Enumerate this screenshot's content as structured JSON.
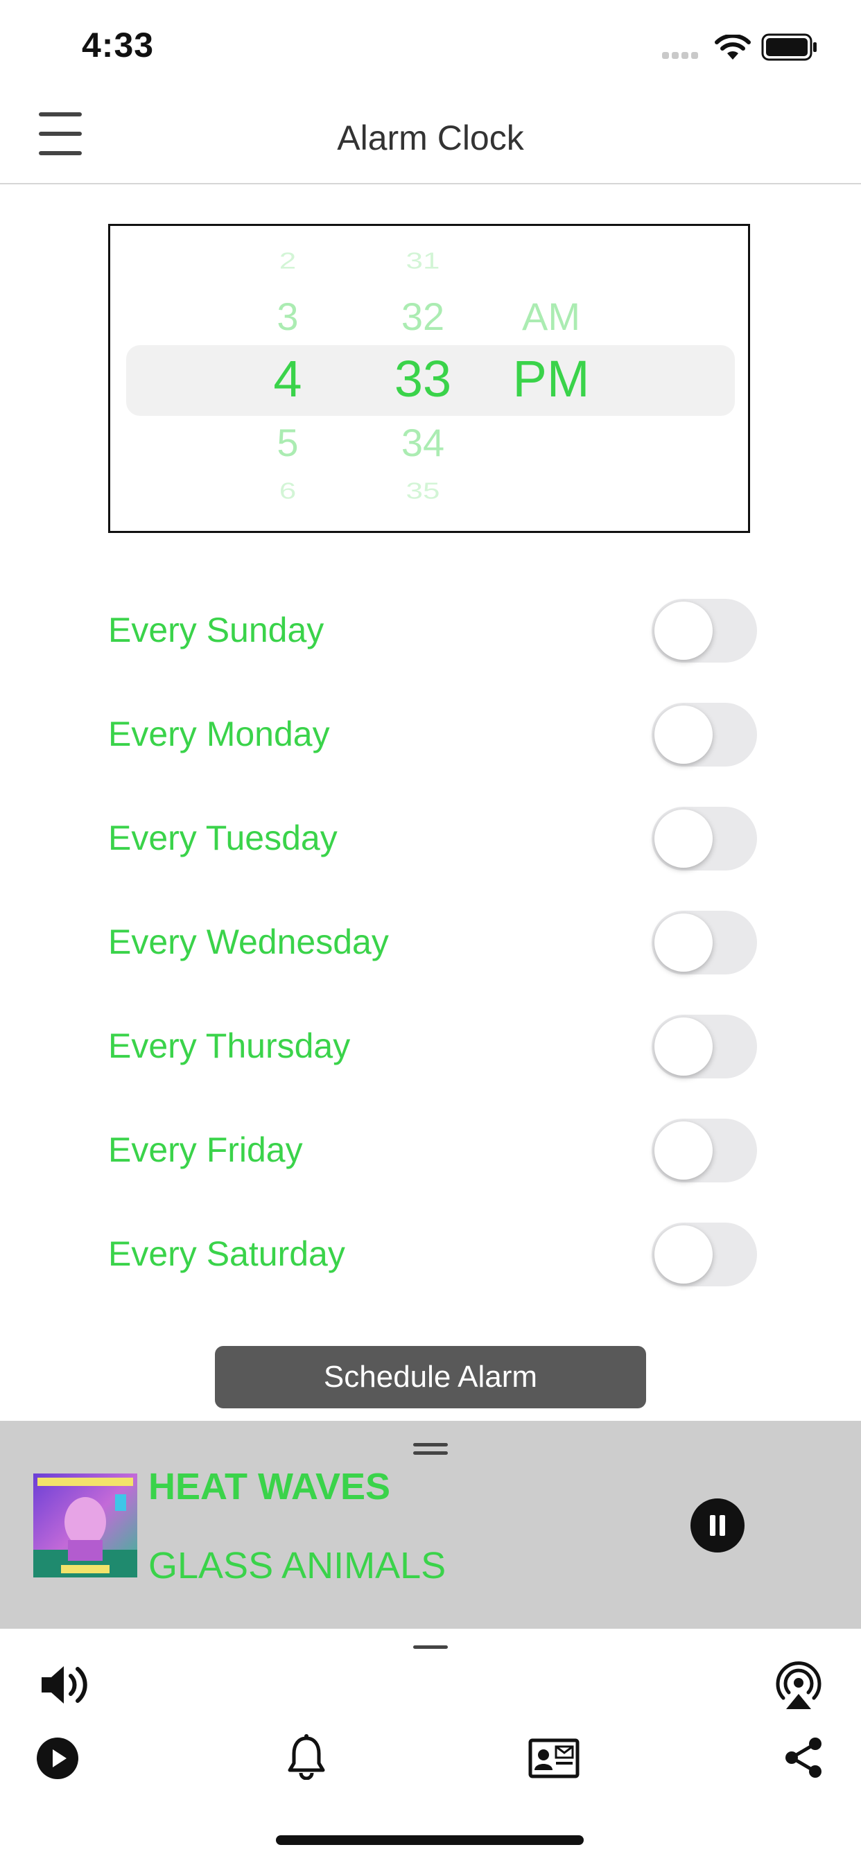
{
  "status_bar": {
    "time": "4:33"
  },
  "nav": {
    "title": "Alarm Clock"
  },
  "picker": {
    "hours": [
      "2",
      "3",
      "4",
      "5",
      "6"
    ],
    "minutes": [
      "31",
      "32",
      "33",
      "34",
      "35"
    ],
    "ampm": [
      "AM",
      "PM"
    ],
    "selected": {
      "hour": "4",
      "minute": "33",
      "ampm": "PM"
    }
  },
  "days": [
    {
      "label": "Every Sunday",
      "on": false
    },
    {
      "label": "Every Monday",
      "on": false
    },
    {
      "label": "Every Tuesday",
      "on": false
    },
    {
      "label": "Every Wednesday",
      "on": false
    },
    {
      "label": "Every Thursday",
      "on": false
    },
    {
      "label": "Every Friday",
      "on": false
    },
    {
      "label": "Every Saturday",
      "on": false
    }
  ],
  "schedule_button": "Schedule Alarm",
  "now_playing": {
    "song": "HEAT WAVES",
    "artist": "GLASS ANIMALS",
    "state": "playing"
  },
  "colors": {
    "accent": "#3ad34a",
    "button": "#595959",
    "player_bg": "#cdcdcd"
  },
  "icons": {
    "toolbar_top": [
      "speaker-icon",
      "airplay-icon"
    ],
    "toolbar_bottom": [
      "play-icon",
      "bell-icon",
      "contact-card-icon",
      "share-icon"
    ]
  }
}
